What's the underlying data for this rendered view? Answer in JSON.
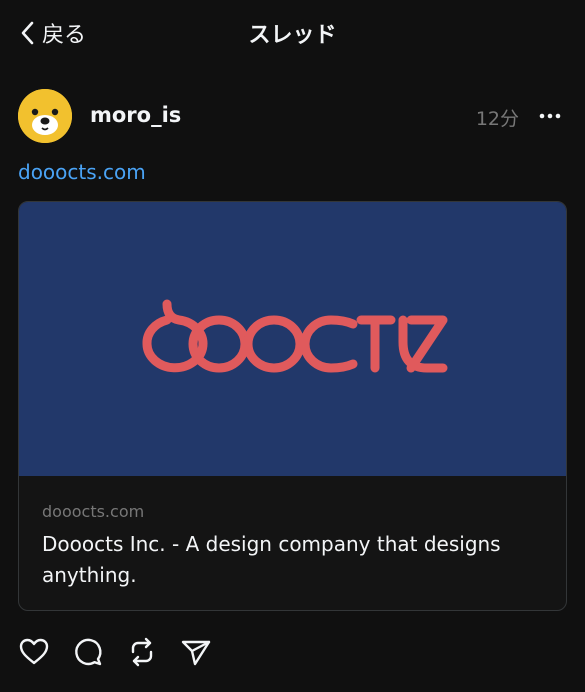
{
  "nav": {
    "back_label": "戻る",
    "title": "スレッド"
  },
  "post": {
    "username": "moro_is",
    "timestamp": "12分",
    "link_text": "dooocts.com"
  },
  "link_card": {
    "logo_text": "dooocts",
    "domain": "dooocts.com",
    "title": "Dooocts Inc. - A design company that designs anything."
  },
  "icons": {
    "back": "chevron-left-icon",
    "more": "more-horizontal-icon",
    "like": "heart-icon",
    "reply": "comment-icon",
    "repost": "repost-icon",
    "share": "send-icon"
  },
  "colors": {
    "background": "#101010",
    "link": "#4aa3f5",
    "card_image_bg": "#22386a",
    "logo": "#e05a5c",
    "avatar": "#f2c12e"
  }
}
